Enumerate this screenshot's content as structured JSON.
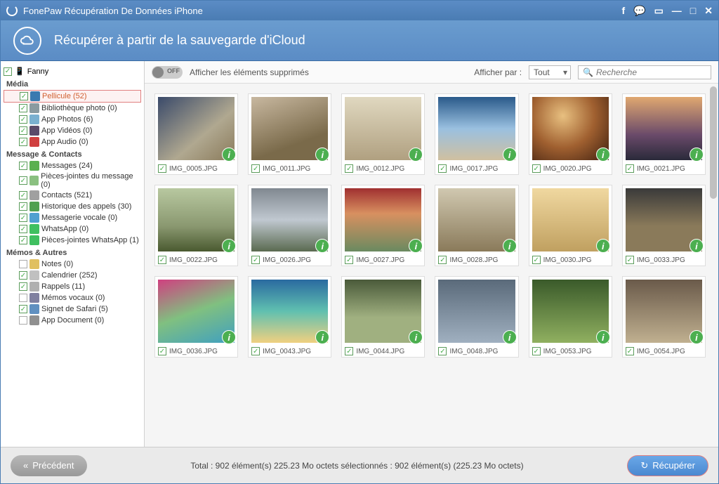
{
  "titlebar": {
    "app_title": "FonePaw Récupération De Données iPhone"
  },
  "header": {
    "title": "Récupérer à partir de la sauvegarde d'iCloud"
  },
  "sidebar": {
    "device_name": "Fanny",
    "cat_media": "Média",
    "cat_msg": "Message & Contacts",
    "cat_memo": "Mémos & Autres",
    "media": [
      {
        "label": "Pellicule (52)",
        "selected": true,
        "color": "#3a7ab0"
      },
      {
        "label": "Bibliothèque photo (0)",
        "color": "#8a9aa0"
      },
      {
        "label": "App Photos (6)",
        "color": "#7ab0d0"
      },
      {
        "label": "App Vidéos (0)",
        "color": "#5a4a6a"
      },
      {
        "label": "App Audio (0)",
        "color": "#d04040"
      }
    ],
    "msg": [
      {
        "label": "Messages (24)",
        "color": "#5ab050"
      },
      {
        "label": "Pièces-jointes du message (0)",
        "color": "#8ac080"
      },
      {
        "label": "Contacts (521)",
        "color": "#a0a0a0"
      },
      {
        "label": "Historique des appels (30)",
        "color": "#50a050"
      },
      {
        "label": "Messagerie vocale (0)",
        "color": "#50a0d0"
      },
      {
        "label": "WhatsApp (0)",
        "color": "#40c060"
      },
      {
        "label": "Pièces-jointes WhatsApp (1)",
        "color": "#40c060"
      }
    ],
    "memo": [
      {
        "label": "Notes (0)",
        "checked": false,
        "color": "#e0c060"
      },
      {
        "label": "Calendrier (252)",
        "color": "#c0c0c0"
      },
      {
        "label": "Rappels (11)",
        "color": "#b0b0b0"
      },
      {
        "label": "Mémos vocaux (0)",
        "checked": false,
        "color": "#8080a0"
      },
      {
        "label": "Signet de Safari (5)",
        "color": "#6090c0"
      },
      {
        "label": "App Document (0)",
        "checked": false,
        "color": "#909090"
      }
    ]
  },
  "toolbar": {
    "toggle_off": "OFF",
    "toggle_label": "Afficher les éléments supprimés",
    "display_by": "Afficher par :",
    "filter_value": "Tout",
    "search_placeholder": "Recherche"
  },
  "grid": [
    {
      "name": "IMG_0005.JPG",
      "g": "g1"
    },
    {
      "name": "IMG_0011.JPG",
      "g": "g2"
    },
    {
      "name": "IMG_0012.JPG",
      "g": "g3"
    },
    {
      "name": "IMG_0017.JPG",
      "g": "g4"
    },
    {
      "name": "IMG_0020.JPG",
      "g": "g5"
    },
    {
      "name": "IMG_0021.JPG",
      "g": "g6"
    },
    {
      "name": "IMG_0022.JPG",
      "g": "g7"
    },
    {
      "name": "IMG_0026.JPG",
      "g": "g8"
    },
    {
      "name": "IMG_0027.JPG",
      "g": "g9"
    },
    {
      "name": "IMG_0028.JPG",
      "g": "g10"
    },
    {
      "name": "IMG_0030.JPG",
      "g": "g11"
    },
    {
      "name": "IMG_0033.JPG",
      "g": "g12"
    },
    {
      "name": "IMG_0036.JPG",
      "g": "g13"
    },
    {
      "name": "IMG_0043.JPG",
      "g": "g14"
    },
    {
      "name": "IMG_0044.JPG",
      "g": "g15"
    },
    {
      "name": "IMG_0048.JPG",
      "g": "g16"
    },
    {
      "name": "IMG_0053.JPG",
      "g": "g17"
    },
    {
      "name": "IMG_0054.JPG",
      "g": "g18"
    }
  ],
  "footer": {
    "prev": "Précédent",
    "status": "Total : 902 élément(s) 225.23 Mo octets sélectionnés : 902 élément(s) (225.23 Mo octets)",
    "recover": "Récupérer"
  }
}
